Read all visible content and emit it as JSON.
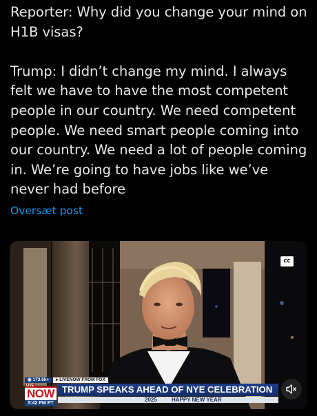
{
  "post": {
    "paragraphs": [
      "Reporter: Why did you change your mind on H1B visas?",
      "Trump: I didn’t change my mind. I always felt we have to have the most competent people in our country. We need competent people. We need smart people coming into our country. We need a lot of people coming in. We’re going to have jobs like we’ve never had before"
    ],
    "translate_label": "Oversæt post"
  },
  "video": {
    "cc_label": "CC",
    "icons": [
      "closed-captions-icon",
      "eye-icon",
      "volume-muted-icon"
    ],
    "chyron": {
      "views": "173.6k+",
      "live_from": "LIVENOW FROM FOX",
      "live_small": "LIVE",
      "now_word": "NOW",
      "time": "5:42 PM PT",
      "headline": "TRUMP SPEAKS AHEAD OF NYE CELEBRATION",
      "ticker_year": "2025",
      "ticker_text": "HAPPY NEW YEAR"
    }
  },
  "colors": {
    "background": "#000000",
    "text": "#e7e9ea",
    "link": "#1d9bf0",
    "fox_blue": "#1a3f7a",
    "fox_red": "#c5141b"
  }
}
